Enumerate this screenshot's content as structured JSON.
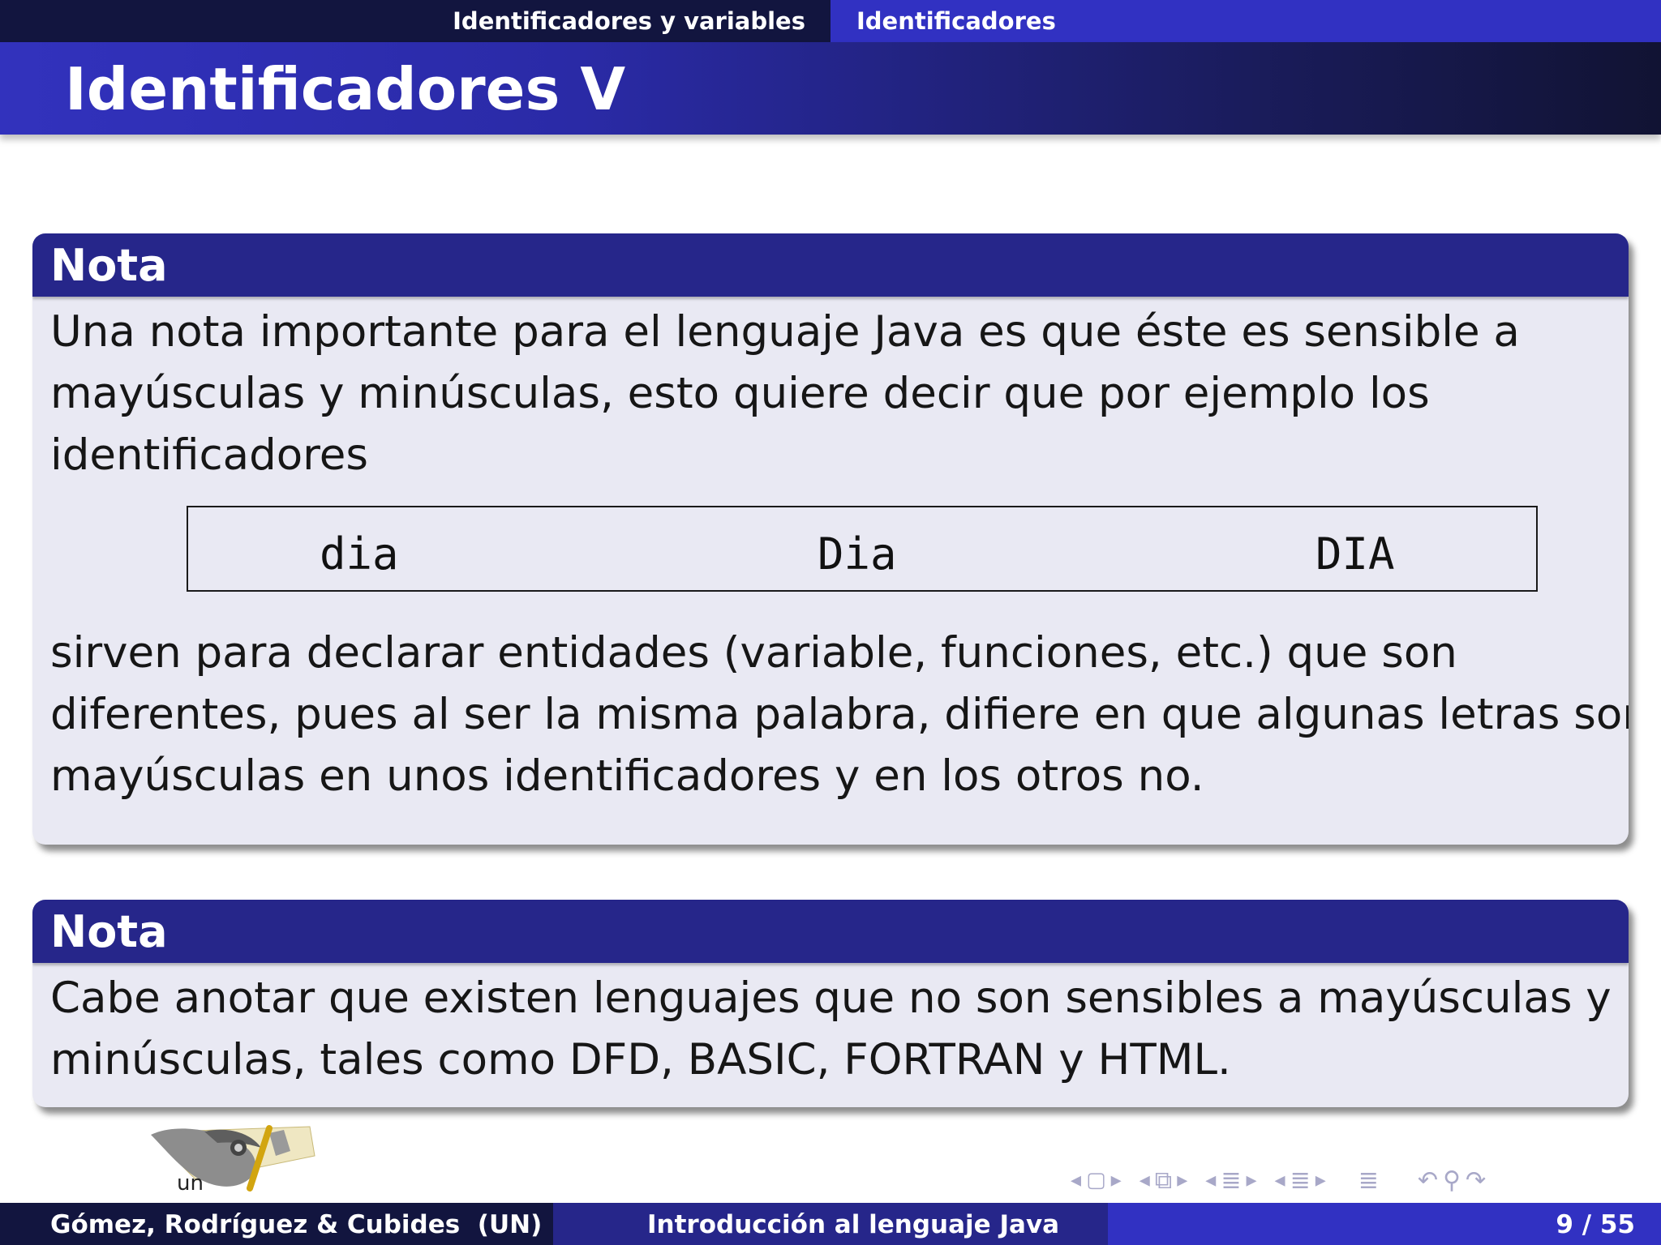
{
  "nav": {
    "section": "Identificadores y variables",
    "subsection": "Identificadores"
  },
  "frame_title": "Identificadores V",
  "note1": {
    "title": "Nota",
    "line1": "Una nota importante para el lenguaje Java es que éste es sensible a",
    "line2": "mayúsculas y minúsculas, esto quiere decir que por ejemplo los",
    "line3": "identificadores",
    "ids": [
      "dia",
      "Dia",
      "DIA"
    ],
    "line4": "sirven para declarar entidades (variable, funciones, etc.) que son",
    "line5": "diferentes, pues al ser la misma palabra, difiere en que algunas letras son",
    "line6": "mayúsculas en unos identificadores y en los otros no."
  },
  "note2": {
    "title": "Nota",
    "line1": "Cabe anotar que existen lenguajes que no son sensibles a mayúsculas y",
    "line2": "minúsculas, tales como DFD, BASIC, FORTRAN y HTML."
  },
  "logo_text": "un",
  "footer": {
    "authors": "Gómez, Rodríguez & Cubides  (UN)",
    "title": "Introducción al lenguaje Java",
    "page": "9 / 55"
  },
  "colors": {
    "dark_navy": "#12153f",
    "mid_blue": "#26268a",
    "bright_blue": "#3131c2",
    "block_bg": "#e9e9f3"
  }
}
